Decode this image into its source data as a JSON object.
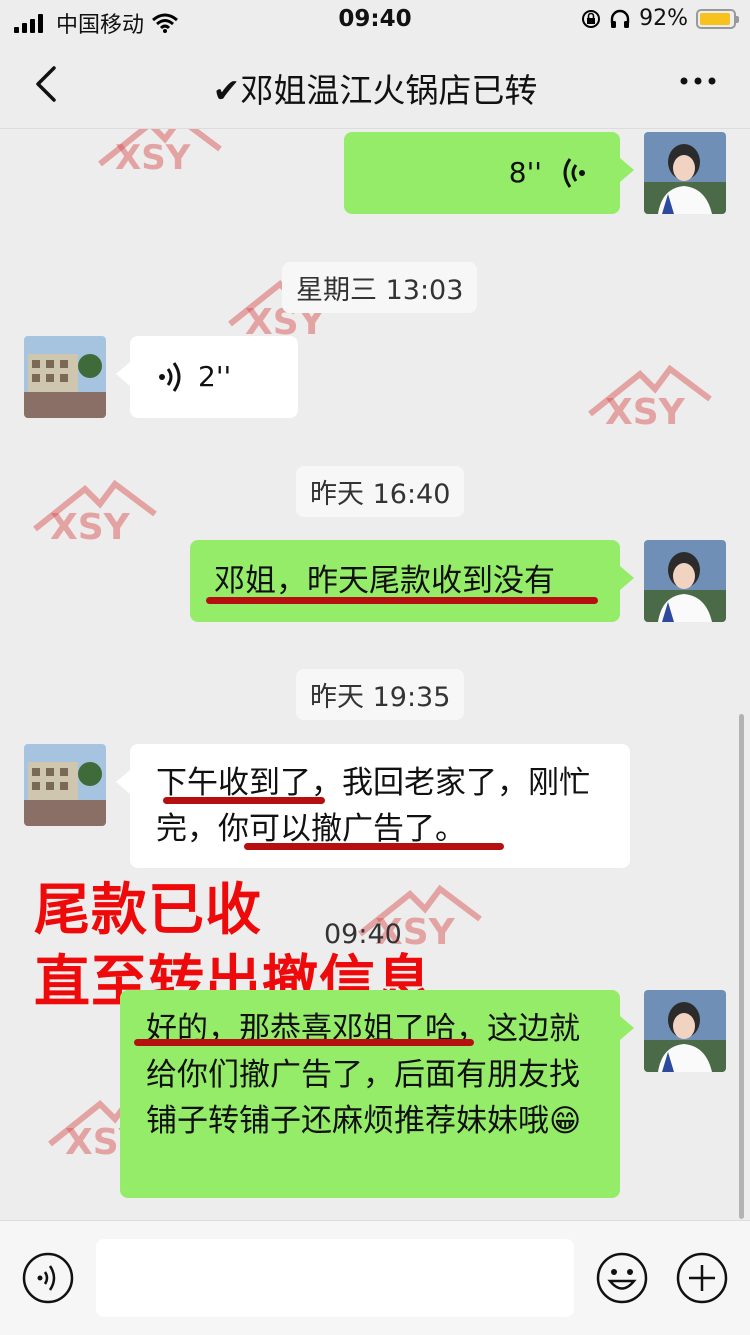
{
  "status_bar": {
    "carrier": "中国移动",
    "time": "09:40",
    "battery": "92%"
  },
  "nav": {
    "title": "✔邓姐温江火锅店已转"
  },
  "messages": {
    "voice_out": {
      "duration": "8''"
    },
    "time1": "星期三 13:03",
    "voice_in": {
      "duration": "2''"
    },
    "time2": "昨天 16:40",
    "text_out_1": "邓姐，昨天尾款收到没有",
    "time3": "昨天 19:35",
    "text_in_1": "下午收到了，我回老家了，刚忙完，你可以撤广告了。",
    "time4": "09:40",
    "text_out_2": "好的，那恭喜邓姐了哈，这边就给你们撤广告了，后面有朋友找铺子转铺子还麻烦推荐妹妹哦😁"
  },
  "overlay": {
    "line1": "尾款已收",
    "line2": "直至转出撤信息"
  },
  "icons": [
    "back-arrow-icon",
    "more-icon",
    "voice-icon",
    "emoji-icon",
    "plus-icon"
  ],
  "colors": {
    "bubble_green": "#95ec69",
    "overlay_red": "#ee0a0a",
    "underline_red": "#b60f0f"
  }
}
